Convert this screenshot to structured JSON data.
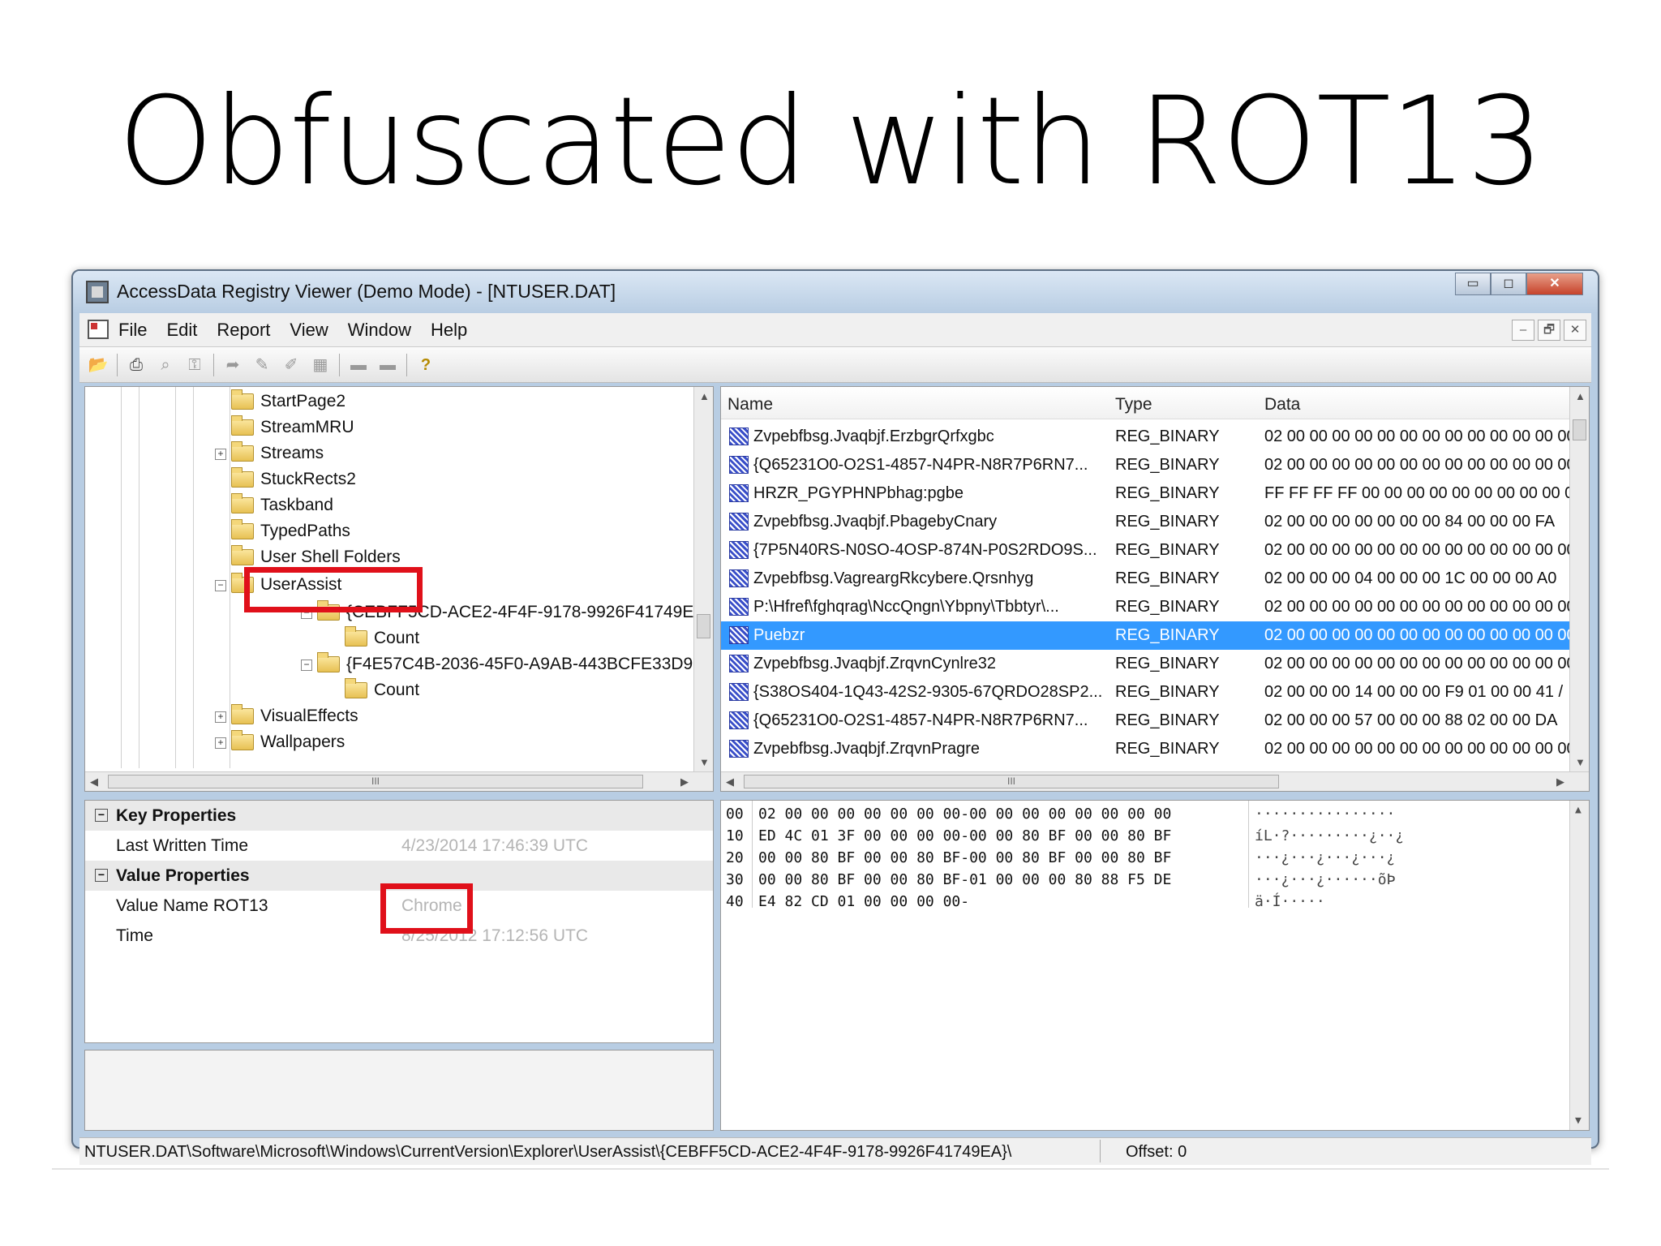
{
  "slide": {
    "title": "Obfuscated with ROT13"
  },
  "window": {
    "title": "AccessData Registry Viewer (Demo Mode) - [NTUSER.DAT]",
    "controls": {
      "minimize": "▭",
      "maximize": "◻",
      "close": "✕"
    }
  },
  "menu": {
    "items": [
      "File",
      "Edit",
      "Report",
      "View",
      "Window",
      "Help"
    ],
    "mdi": {
      "minimize": "–",
      "restore": "🗗",
      "close": "✕"
    }
  },
  "toolbar": {
    "buttons": [
      "open-icon",
      "print-icon",
      "preview-icon",
      "key-icon",
      "export-icon",
      "edit-icon",
      "edit2-icon",
      "grid-icon",
      "tape-icon",
      "tape2-icon",
      "help-icon"
    ]
  },
  "tree": {
    "nodes": [
      {
        "label": "StartPage2",
        "expander": ""
      },
      {
        "label": "StreamMRU",
        "expander": ""
      },
      {
        "label": "Streams",
        "expander": "+"
      },
      {
        "label": "StuckRects2",
        "expander": ""
      },
      {
        "label": "Taskband",
        "expander": ""
      },
      {
        "label": "TypedPaths",
        "expander": ""
      },
      {
        "label": "User Shell Folders",
        "expander": ""
      },
      {
        "label": "UserAssist",
        "expander": "−"
      },
      {
        "label": "{CEBFF5CD-ACE2-4F4F-9178-9926F41749EA}",
        "expander": "−"
      },
      {
        "label": "Count",
        "expander": ""
      },
      {
        "label": "{F4E57C4B-2036-45F0-A9AB-443BCFE33D9F}",
        "expander": "−"
      },
      {
        "label": "Count",
        "expander": ""
      },
      {
        "label": "VisualEffects",
        "expander": "+"
      },
      {
        "label": "Wallpapers",
        "expander": "+"
      }
    ],
    "hscroll_thumb": "III"
  },
  "values": {
    "headers": {
      "name": "Name",
      "type": "Type",
      "data": "Data"
    },
    "rows": [
      {
        "name": "Zvpebfbsg.Jvaqbjf.ErzbgrQrfxgbc",
        "type": "REG_BINARY",
        "data": "02 00 00 00 00 00 00 00 00 00 00 00 00 00 ("
      },
      {
        "name": "{Q65231O0-O2S1-4857-N4PR-N8R7P6RN7...",
        "type": "REG_BINARY",
        "data": "02 00 00 00 00 00 00 00 00 00 00 00 00 00 ("
      },
      {
        "name": "HRZR_PGYPHNPbhag:pgbe",
        "type": "REG_BINARY",
        "data": "FF FF FF FF 00 00 00 00 00 00 00 00 00 00 ("
      },
      {
        "name": "Zvpebfbsg.Jvaqbjf.PbagebyCnary",
        "type": "REG_BINARY",
        "data": "02 00 00 00 00 00 00 00 84 00 00 00 FA"
      },
      {
        "name": "{7P5N40RS-N0SO-4OSP-874N-P0S2RDO9S...",
        "type": "REG_BINARY",
        "data": "02 00 00 00 00 00 00 00 00 00 00 00 00 00 ("
      },
      {
        "name": "Zvpebfbsg.VagreargRkcybere.Qrsnhyg",
        "type": "REG_BINARY",
        "data": "02 00 00 00 04 00 00 00 1C 00 00 00 A0"
      },
      {
        "name": "P:\\Hfref\\fghqrag\\NccQngn\\Ybpny\\Tbbtyr\\...",
        "type": "REG_BINARY",
        "data": "02 00 00 00 00 00 00 00 00 00 00 00 00 00 ("
      },
      {
        "name": "Puebzr",
        "type": "REG_BINARY",
        "data": "02 00 00 00 00 00 00 00 00 00 00 00 00 00 ("
      },
      {
        "name": "Zvpebfbsg.Jvaqbjf.ZrqvnCynlre32",
        "type": "REG_BINARY",
        "data": "02 00 00 00 00 00 00 00 00 00 00 00 00 00 ("
      },
      {
        "name": "{S38OS404-1Q43-42S2-9305-67QRDO28SP2...",
        "type": "REG_BINARY",
        "data": "02 00 00 00 14 00 00 00 F9 01 00 00 41 /"
      },
      {
        "name": "{Q65231O0-O2S1-4857-N4PR-N8R7P6RN7...",
        "type": "REG_BINARY",
        "data": "02 00 00 00 57 00 00 00 88 02 00 00 DA"
      },
      {
        "name": "Zvpebfbsg.Jvaqbjf.ZrqvnPragre",
        "type": "REG_BINARY",
        "data": "02 00 00 00 00 00 00 00 00 00 00 00 00 00 ("
      }
    ],
    "selected_index": 7,
    "hscroll_thumb": "III"
  },
  "properties": {
    "key_header": "Key Properties",
    "last_written_label": "Last Written Time",
    "last_written_value": "4/23/2014 17:46:39 UTC",
    "value_header": "Value Properties",
    "value_name_label": "Value Name ROT13",
    "value_name_value": "Chrome",
    "time_label": "Time",
    "time_value": "8/25/2012 17:12:56 UTC"
  },
  "hex": {
    "rows": [
      {
        "offset": "00",
        "bytes": "02 00 00 00 00 00 00 00-00 00 00 00 00 00 00 00",
        "ascii": "················"
      },
      {
        "offset": "10",
        "bytes": "ED 4C 01 3F 00 00 00 00-00 00 80 BF 00 00 80 BF",
        "ascii": "íL·?·········¿··¿"
      },
      {
        "offset": "20",
        "bytes": "00 00 80 BF 00 00 80 BF-00 00 80 BF 00 00 80 BF",
        "ascii": "···¿···¿···¿···¿"
      },
      {
        "offset": "30",
        "bytes": "00 00 80 BF 00 00 80 BF-01 00 00 00 80 88 F5 DE",
        "ascii": "···¿···¿······õÞ"
      },
      {
        "offset": "40",
        "bytes": "E4 82 CD 01 00 00 00 00-",
        "ascii": "ä·Í·····"
      }
    ]
  },
  "status": {
    "path": "NTUSER.DAT\\Software\\Microsoft\\Windows\\CurrentVersion\\Explorer\\UserAssist\\{CEBFF5CD-ACE2-4F4F-9178-9926F41749EA}\\",
    "offset": "Offset: 0"
  },
  "colors": {
    "highlight_box": "#e0101a",
    "selection": "#3399ff"
  }
}
